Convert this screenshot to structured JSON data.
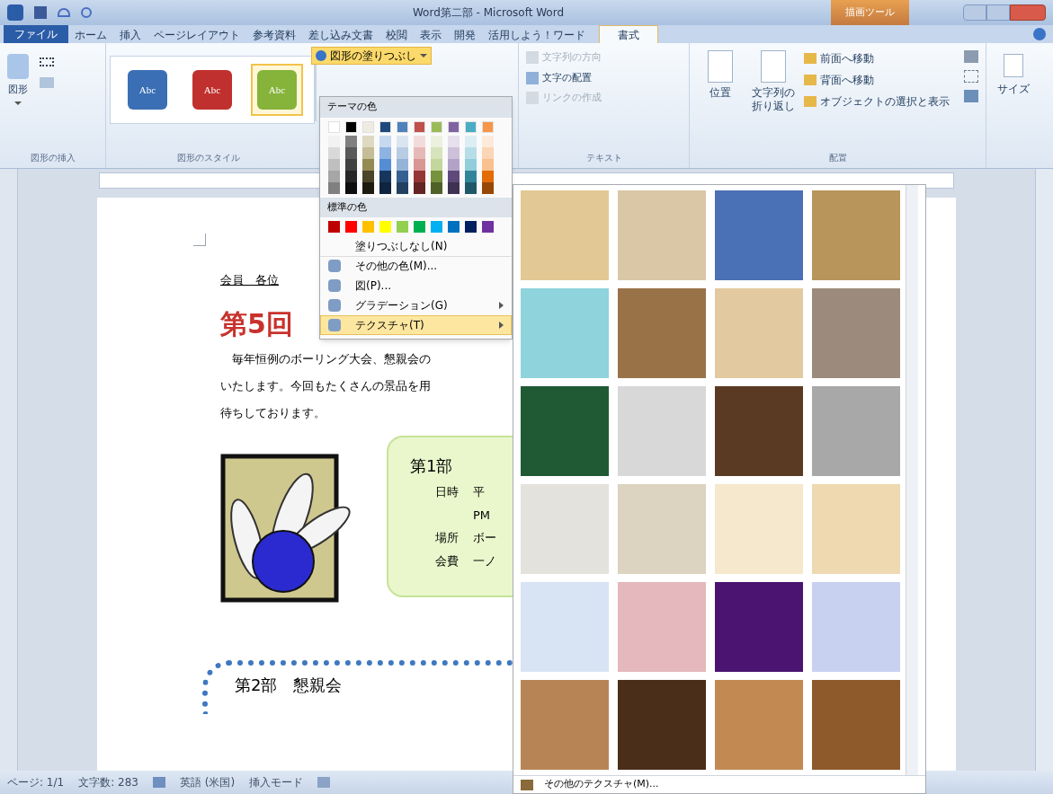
{
  "window": {
    "title": "Word第二部 - Microsoft Word",
    "context_tab": "描画ツール"
  },
  "tabs": [
    {
      "label": "ファイル",
      "kind": "file",
      "selected": false
    },
    {
      "label": "ホーム",
      "kind": "tab",
      "selected": false
    },
    {
      "label": "挿入",
      "kind": "tab",
      "selected": false
    },
    {
      "label": "ページレイアウト",
      "kind": "tab",
      "selected": false
    },
    {
      "label": "参考資料",
      "kind": "tab",
      "selected": false
    },
    {
      "label": "差し込み文書",
      "kind": "tab",
      "selected": false
    },
    {
      "label": "校閲",
      "kind": "tab",
      "selected": false
    },
    {
      "label": "表示",
      "kind": "tab",
      "selected": false
    },
    {
      "label": "開発",
      "kind": "tab",
      "selected": false
    },
    {
      "label": "活用しよう！ワード",
      "kind": "tab",
      "selected": false
    },
    {
      "label": "書式",
      "kind": "tab",
      "selected": true
    }
  ],
  "ribbon": {
    "insert_group": {
      "label": "図形の挿入",
      "button": "図形"
    },
    "style_group": {
      "label": "図形のスタイル",
      "styles": [
        {
          "text": "Abc",
          "color": "#3a6fb5",
          "selected": false
        },
        {
          "text": "Abc",
          "color": "#c0302e",
          "selected": false
        },
        {
          "text": "Abc",
          "color": "#86b33a",
          "selected": true
        }
      ]
    },
    "fill_button": {
      "label": "図形の塗りつぶし",
      "open": true
    },
    "text_group": {
      "label": "テキスト",
      "items": [
        {
          "label": "文字列の方向",
          "disabled": true
        },
        {
          "label": "文字の配置",
          "disabled": false
        },
        {
          "label": "リンクの作成",
          "disabled": true
        }
      ]
    },
    "arrange_group": {
      "label": "配置",
      "large": [
        "位置",
        "文字列の折り返し"
      ],
      "items": [
        "前面へ移動",
        "背面へ移動",
        "オブジェクトの選択と表示"
      ]
    },
    "size_button": "サイズ"
  },
  "fill_menu": {
    "theme_heading": "テーマの色",
    "theme_colors": [
      {
        "color": "#ffffff",
        "shades": [
          {
            "color": "#f2f2f2"
          },
          {
            "color": "#d9d9d9"
          },
          {
            "color": "#bfbfbf"
          },
          {
            "color": "#a6a6a6"
          },
          {
            "color": "#808080"
          }
        ]
      },
      {
        "color": "#000000",
        "shades": [
          {
            "color": "#808080"
          },
          {
            "color": "#595959"
          },
          {
            "color": "#404040"
          },
          {
            "color": "#262626"
          },
          {
            "color": "#0d0d0d"
          }
        ]
      },
      {
        "color": "#eeece1",
        "shades": [
          {
            "color": "#ddd9c3"
          },
          {
            "color": "#c4bd97"
          },
          {
            "color": "#948a54"
          },
          {
            "color": "#4a452a"
          },
          {
            "color": "#1d1b10"
          }
        ]
      },
      {
        "color": "#1f497d",
        "shades": [
          {
            "color": "#c6d9f0"
          },
          {
            "color": "#8db3e2"
          },
          {
            "color": "#548dd4"
          },
          {
            "color": "#17365d"
          },
          {
            "color": "#0f243e"
          }
        ]
      },
      {
        "color": "#4f81bd",
        "shades": [
          {
            "color": "#dbe5f1"
          },
          {
            "color": "#b8cce4"
          },
          {
            "color": "#95b3d7"
          },
          {
            "color": "#366092"
          },
          {
            "color": "#244061"
          }
        ]
      },
      {
        "color": "#c0504d",
        "shades": [
          {
            "color": "#f2dcdb"
          },
          {
            "color": "#e5b9b7"
          },
          {
            "color": "#d99694"
          },
          {
            "color": "#953734"
          },
          {
            "color": "#632423"
          }
        ]
      },
      {
        "color": "#9bbb59",
        "shades": [
          {
            "color": "#ebf1dd"
          },
          {
            "color": "#d7e3bc"
          },
          {
            "color": "#c3d69b"
          },
          {
            "color": "#76923c"
          },
          {
            "color": "#4f6128"
          }
        ]
      },
      {
        "color": "#8064a2",
        "shades": [
          {
            "color": "#e5e0ec"
          },
          {
            "color": "#ccc1d9"
          },
          {
            "color": "#b2a2c7"
          },
          {
            "color": "#5f497a"
          },
          {
            "color": "#3f3151"
          }
        ]
      },
      {
        "color": "#4bacc6",
        "shades": [
          {
            "color": "#dbeef3"
          },
          {
            "color": "#b7dde8"
          },
          {
            "color": "#92cddc"
          },
          {
            "color": "#31859b"
          },
          {
            "color": "#205867"
          }
        ]
      },
      {
        "color": "#f79646",
        "shades": [
          {
            "color": "#fdeada"
          },
          {
            "color": "#fbd5b5"
          },
          {
            "color": "#fac08f"
          },
          {
            "color": "#e36c09"
          },
          {
            "color": "#974806"
          }
        ]
      }
    ],
    "standard_heading": "標準の色",
    "standard_colors": [
      {
        "color": "#c00000"
      },
      {
        "color": "#ff0000"
      },
      {
        "color": "#ffc000"
      },
      {
        "color": "#ffff00"
      },
      {
        "color": "#92d050"
      },
      {
        "color": "#00b050"
      },
      {
        "color": "#00b0f0"
      },
      {
        "color": "#0070c0"
      },
      {
        "color": "#002060"
      },
      {
        "color": "#7030a0"
      }
    ],
    "items": [
      {
        "label": "塗りつぶしなし(N)",
        "kind": "plain",
        "selected": false
      },
      {
        "label": "その他の色(M)...",
        "kind": "plain",
        "selected": false
      },
      {
        "label": "図(P)...",
        "kind": "plain",
        "selected": false
      },
      {
        "label": "グラデーション(G)",
        "kind": "submenu",
        "selected": false
      },
      {
        "label": "テクスチャ(T)",
        "kind": "submenu",
        "selected": true
      }
    ]
  },
  "texture_gallery": {
    "textures": [
      {
        "color": "#e2c894"
      },
      {
        "color": "#d9c7a5"
      },
      {
        "color": "#4a70b5"
      },
      {
        "color": "#b8955a"
      },
      {
        "color": "#8fd3dc"
      },
      {
        "color": "#9a7248"
      },
      {
        "color": "#e3c9a0"
      },
      {
        "color": "#9c8b7c"
      },
      {
        "color": "#1f5a35"
      },
      {
        "color": "#d8d8d8"
      },
      {
        "color": "#5a3a22"
      },
      {
        "color": "#a8a8a8"
      },
      {
        "color": "#e4e2dc"
      },
      {
        "color": "#dcd3c0"
      },
      {
        "color": "#f5e8cc"
      },
      {
        "color": "#eed9b0"
      },
      {
        "color": "#d8e4f4"
      },
      {
        "color": "#e4b8bc"
      },
      {
        "color": "#4b1470"
      },
      {
        "color": "#c8d2f0"
      },
      {
        "color": "#b78555"
      },
      {
        "color": "#4a2e1a"
      },
      {
        "color": "#c28a52"
      },
      {
        "color": "#8e5a2c"
      }
    ],
    "footer": "その他のテクスチャ(M)..."
  },
  "document": {
    "addressee": "会員　各位",
    "title": "第5回",
    "paragraph": [
      "毎年恒例のボーリング大会、懇親会の",
      "いたします。今回もたくさんの景品を用",
      "待ちしております。"
    ],
    "scroll": {
      "heading": "第1部",
      "rows": [
        {
          "label": "日時",
          "value": "平"
        },
        {
          "label": "",
          "value": "PM"
        },
        {
          "label": "場所",
          "value": "ボー"
        },
        {
          "label": "会費",
          "value": "一ノ"
        }
      ]
    },
    "section2": "第2部　懇親会"
  },
  "status_bar": {
    "page": "ページ: 1/1",
    "words": "文字数: 283",
    "language": "英語 (米国)",
    "mode": "挿入モード"
  }
}
